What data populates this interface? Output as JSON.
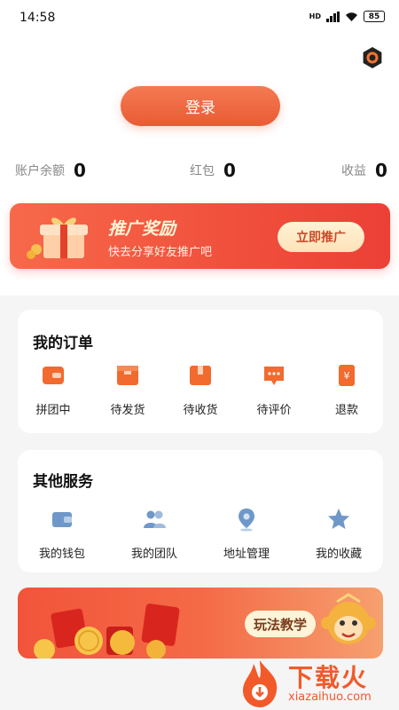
{
  "status_bar": {
    "time": "14:58",
    "network": "HD",
    "battery": "85"
  },
  "header": {
    "login_label": "登录"
  },
  "stats": [
    {
      "label": "账户余额",
      "value": "0"
    },
    {
      "label": "红包",
      "value": "0"
    },
    {
      "label": "收益",
      "value": "0"
    }
  ],
  "promo": {
    "title": "推广奖励",
    "subtitle": "快去分享好友推广吧",
    "button": "立即推广"
  },
  "orders": {
    "title": "我的订单",
    "items": [
      {
        "label": "拼团中",
        "icon": "wallet-card-icon"
      },
      {
        "label": "待发货",
        "icon": "box-icon"
      },
      {
        "label": "待收货",
        "icon": "package-icon"
      },
      {
        "label": "待评价",
        "icon": "comment-icon"
      },
      {
        "label": "退款",
        "icon": "refund-icon"
      }
    ]
  },
  "services": {
    "title": "其他服务",
    "items": [
      {
        "label": "我的钱包",
        "icon": "wallet-icon"
      },
      {
        "label": "我的团队",
        "icon": "team-icon"
      },
      {
        "label": "地址管理",
        "icon": "location-icon"
      },
      {
        "label": "我的收藏",
        "icon": "star-icon"
      }
    ]
  },
  "banner": {
    "button": "玩法教学"
  },
  "watermark": {
    "title": "下载火",
    "url": "xiazaihuo.com"
  },
  "colors": {
    "accent": "#ef5a36",
    "order_icon": "#f26a2e",
    "service_icon": "#6f98c9"
  }
}
